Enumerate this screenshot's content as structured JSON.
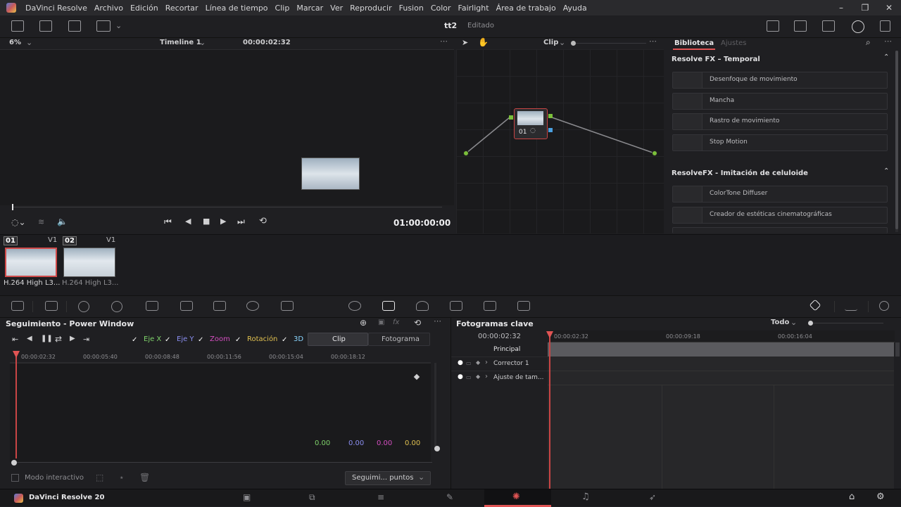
{
  "menu": [
    "DaVinci Resolve",
    "Archivo",
    "Edición",
    "Recortar",
    "Línea de tiempo",
    "Clip",
    "Marcar",
    "Ver",
    "Reproducir",
    "Fusion",
    "Color",
    "Fairlight",
    "Área de trabajo",
    "Ayuda"
  ],
  "toolbar": {
    "project": "tt2",
    "status": "Editado"
  },
  "viewer": {
    "zoom": "6%",
    "timeline": "Timeline 1",
    "timecode": "00:00:02:32",
    "playhead_tc": "01:00:00:00"
  },
  "nodes": {
    "mode": "Clip",
    "node_label": "01"
  },
  "library": {
    "tab_active": "Biblioteca",
    "tab_inactive": "Ajustes",
    "section1": "Resolve FX – Temporal",
    "items1": [
      "Desenfoque de movimiento",
      "Mancha",
      "Rastro de movimiento",
      "Stop Motion"
    ],
    "section2": "ResolveFX - Imitación de celuloide",
    "items2": [
      "ColorTone Diffuser",
      "Creador de estéticas cinematográficas"
    ]
  },
  "clips": [
    {
      "num": "01",
      "track": "V1",
      "name": "H.264 High L3..."
    },
    {
      "num": "02",
      "track": "V1",
      "name": "H.264 High L3..."
    }
  ],
  "tracker": {
    "title": "Seguimiento - Power Window",
    "axes": [
      "Eje X",
      "Eje Y",
      "Zoom",
      "Rotación",
      "3D"
    ],
    "axis_colors": [
      "#7fd36b",
      "#8a8ef0",
      "#d44ec0",
      "#e0c050",
      "#8ad6ff"
    ],
    "tabs": [
      "Clip",
      "Fotograma"
    ],
    "ruler": [
      "00:00:02:32",
      "00:00:05:40",
      "00:00:08:48",
      "00:00:11:56",
      "00:00:15:04",
      "00:00:18:12"
    ],
    "values": [
      "0.00",
      "0.00",
      "0.00",
      "0.00"
    ],
    "interactive": "Modo interactivo",
    "dropdown": "Seguimi... puntos"
  },
  "keyframes": {
    "title": "Fotogramas clave",
    "filter": "Todo",
    "timecode": "00:00:02:32",
    "ruler": [
      "00:00:02:32",
      "00:00:09:18",
      "00:00:16:04"
    ],
    "rows": [
      "Principal",
      "Corrector 1",
      "Ajuste de tam..."
    ]
  },
  "status": {
    "app": "DaVinci Resolve 20"
  }
}
